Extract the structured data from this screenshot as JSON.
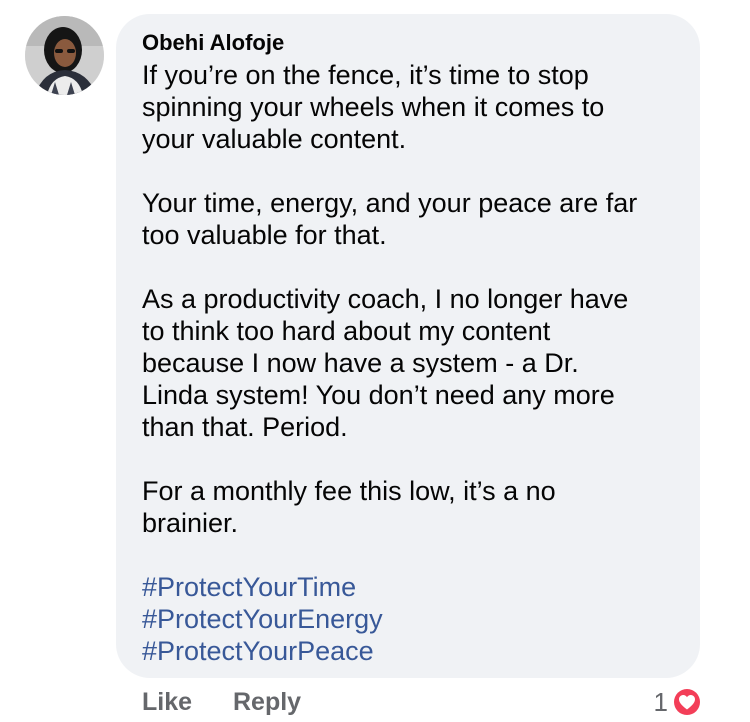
{
  "comment": {
    "author": "Obehi Alofoje",
    "paragraphs": [
      "If you’re on the fence, it’s time to stop\nspinning your wheels when it comes to\nyour valuable content.",
      "Your time, energy,  and your peace are far\ntoo valuable for that.",
      "As a productivity coach, I no longer have\nto think too hard about my content\nbecause I now have a system - a Dr.\nLinda system! You don’t need any more\nthan that. Period.",
      "For a monthly fee this low, it’s a no\nbrainier."
    ],
    "hashtags": [
      "#ProtectYourTime",
      "#ProtectYourEnergy",
      "#ProtectYourPeace"
    ]
  },
  "actions": {
    "like_label": "Like",
    "reply_label": "Reply"
  },
  "reactions": {
    "count": "1",
    "icon": "heart-icon",
    "color": "#f33e58"
  },
  "colors": {
    "bubble": "#f0f2f5",
    "hashtag": "#385898",
    "secondary_text": "#65676b"
  }
}
